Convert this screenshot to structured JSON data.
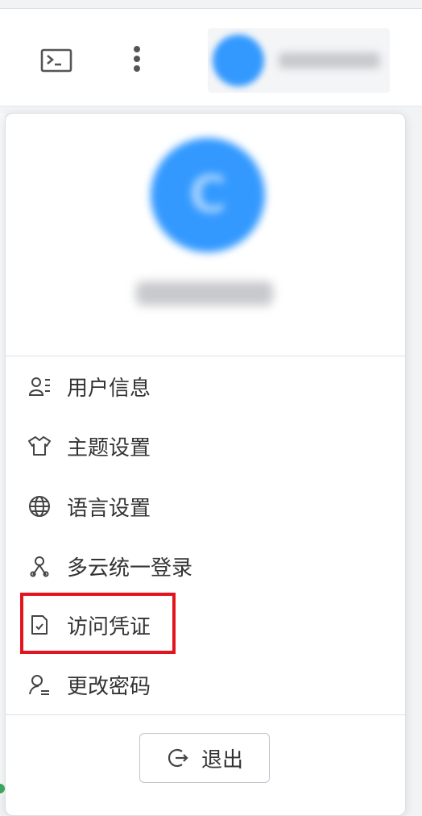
{
  "header": {
    "terminal_icon": "terminal-icon",
    "more_icon": "more-vertical-icon",
    "account": {
      "avatar": "avatar",
      "name": ""
    }
  },
  "profile": {
    "avatar_letter": "C",
    "name": ""
  },
  "menu": {
    "items": [
      {
        "icon": "user-info-icon",
        "label": "用户信息"
      },
      {
        "icon": "shirt-icon",
        "label": "主题设置"
      },
      {
        "icon": "globe-icon",
        "label": "语言设置"
      },
      {
        "icon": "sso-icon",
        "label": "多云统一登录"
      },
      {
        "icon": "credential-icon",
        "label": "访问凭证",
        "highlighted": true
      },
      {
        "icon": "key-user-icon",
        "label": "更改密码"
      }
    ]
  },
  "logout": {
    "icon": "logout-icon",
    "label": "退出"
  },
  "colors": {
    "accent": "#3399ff",
    "highlight": "#e3141e",
    "text": "#333333",
    "border": "#dcdfe6"
  }
}
